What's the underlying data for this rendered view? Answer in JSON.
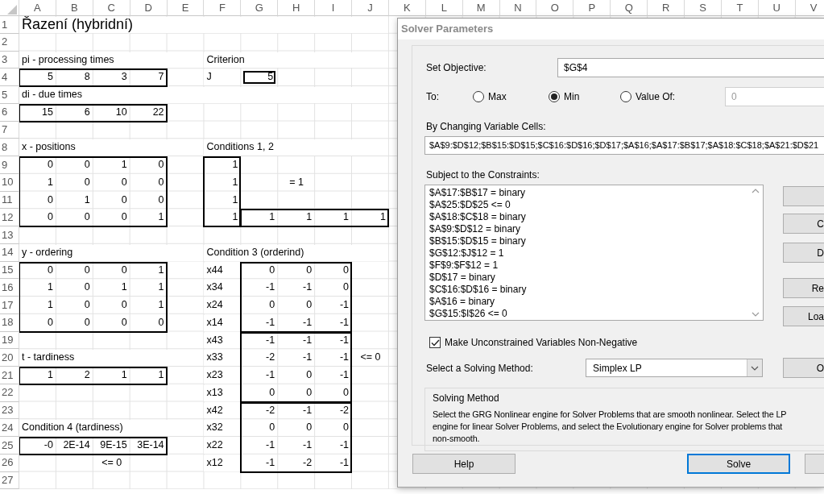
{
  "sheet": {
    "columns": [
      "A",
      "B",
      "C",
      "D",
      "E",
      "F",
      "G",
      "H",
      "I",
      "J",
      "K",
      "L",
      "M",
      "N",
      "O",
      "P",
      "Q",
      "R",
      "S",
      "T",
      "U",
      "V"
    ],
    "rows": [
      {
        "number": "1",
        "cells": [
          {
            "text": "Řazení  (hybridní)",
            "kind": "title"
          }
        ]
      },
      {
        "number": "2"
      },
      {
        "number": "3",
        "cells": [
          {
            "text": "pi  - processing times",
            "kind": "label"
          },
          null,
          null,
          null,
          null,
          {
            "text": "Criterion",
            "kind": "label"
          }
        ]
      },
      {
        "number": "4",
        "cells": [
          {
            "text": "5",
            "kind": "number"
          },
          {
            "text": "8",
            "kind": "number"
          },
          {
            "text": "3",
            "kind": "number"
          },
          {
            "text": "7",
            "kind": "number"
          },
          null,
          {
            "text": "J",
            "kind": "label"
          },
          {
            "text": "5",
            "kind": "number"
          }
        ]
      },
      {
        "number": "5",
        "cells": [
          {
            "text": "di  - due times",
            "kind": "label"
          }
        ]
      },
      {
        "number": "6",
        "cells": [
          {
            "text": "15",
            "kind": "number"
          },
          {
            "text": "6",
            "kind": "number"
          },
          {
            "text": "10",
            "kind": "number"
          },
          {
            "text": "22",
            "kind": "number"
          }
        ]
      },
      {
        "number": "7"
      },
      {
        "number": "8",
        "cells": [
          {
            "text": "x  - positions",
            "kind": "label"
          },
          null,
          null,
          null,
          null,
          {
            "text": "Conditions 1, 2",
            "kind": "label"
          }
        ]
      },
      {
        "number": "9",
        "cells": [
          {
            "text": "0",
            "kind": "number"
          },
          {
            "text": "0",
            "kind": "number"
          },
          {
            "text": "1",
            "kind": "number"
          },
          {
            "text": "0",
            "kind": "number"
          },
          null,
          {
            "text": "1",
            "kind": "number"
          }
        ]
      },
      {
        "number": "10",
        "cells": [
          {
            "text": "1",
            "kind": "number"
          },
          {
            "text": "0",
            "kind": "number"
          },
          {
            "text": "0",
            "kind": "number"
          },
          {
            "text": "0",
            "kind": "number"
          },
          null,
          {
            "text": "1",
            "kind": "number"
          },
          null,
          {
            "text": "= 1",
            "kind": "center"
          }
        ]
      },
      {
        "number": "11",
        "cells": [
          {
            "text": "0",
            "kind": "number"
          },
          {
            "text": "1",
            "kind": "number"
          },
          {
            "text": "0",
            "kind": "number"
          },
          {
            "text": "0",
            "kind": "number"
          },
          null,
          {
            "text": "1",
            "kind": "number"
          }
        ]
      },
      {
        "number": "12",
        "cells": [
          {
            "text": "0",
            "kind": "number"
          },
          {
            "text": "0",
            "kind": "number"
          },
          {
            "text": "0",
            "kind": "number"
          },
          {
            "text": "1",
            "kind": "number"
          },
          null,
          {
            "text": "1",
            "kind": "number"
          },
          {
            "text": "1",
            "kind": "number"
          },
          {
            "text": "1",
            "kind": "number"
          },
          {
            "text": "1",
            "kind": "number"
          },
          {
            "text": "1",
            "kind": "number"
          }
        ]
      },
      {
        "number": "13"
      },
      {
        "number": "14",
        "cells": [
          {
            "text": "y  - ordering",
            "kind": "label"
          },
          null,
          null,
          null,
          null,
          {
            "text": "Condition 3 (orderind)",
            "kind": "label"
          }
        ]
      },
      {
        "number": "15",
        "cells": [
          {
            "text": "0",
            "kind": "number"
          },
          {
            "text": "0",
            "kind": "number"
          },
          {
            "text": "0",
            "kind": "number"
          },
          {
            "text": "1",
            "kind": "number"
          },
          null,
          {
            "text": "x44",
            "kind": "label"
          },
          {
            "text": "0",
            "kind": "number"
          },
          {
            "text": "0",
            "kind": "number"
          },
          {
            "text": "0",
            "kind": "number"
          }
        ]
      },
      {
        "number": "16",
        "cells": [
          {
            "text": "1",
            "kind": "number"
          },
          {
            "text": "0",
            "kind": "number"
          },
          {
            "text": "1",
            "kind": "number"
          },
          {
            "text": "1",
            "kind": "number"
          },
          null,
          {
            "text": "x34",
            "kind": "label"
          },
          {
            "text": "-1",
            "kind": "number"
          },
          {
            "text": "-1",
            "kind": "number"
          },
          {
            "text": "0",
            "kind": "number"
          }
        ]
      },
      {
        "number": "17",
        "cells": [
          {
            "text": "1",
            "kind": "number"
          },
          {
            "text": "0",
            "kind": "number"
          },
          {
            "text": "0",
            "kind": "number"
          },
          {
            "text": "1",
            "kind": "number"
          },
          null,
          {
            "text": "x24",
            "kind": "label"
          },
          {
            "text": "0",
            "kind": "number"
          },
          {
            "text": "0",
            "kind": "number"
          },
          {
            "text": "-1",
            "kind": "number"
          }
        ]
      },
      {
        "number": "18",
        "cells": [
          {
            "text": "0",
            "kind": "number"
          },
          {
            "text": "0",
            "kind": "number"
          },
          {
            "text": "0",
            "kind": "number"
          },
          {
            "text": "0",
            "kind": "number"
          },
          null,
          {
            "text": "x14",
            "kind": "label"
          },
          {
            "text": "-1",
            "kind": "number"
          },
          {
            "text": "-1",
            "kind": "number"
          },
          {
            "text": "-1",
            "kind": "number"
          }
        ]
      },
      {
        "number": "19",
        "cells": [
          null,
          null,
          null,
          null,
          null,
          {
            "text": "x43",
            "kind": "label"
          },
          {
            "text": "-1",
            "kind": "number"
          },
          {
            "text": "-1",
            "kind": "number"
          },
          {
            "text": "-1",
            "kind": "number"
          }
        ]
      },
      {
        "number": "20",
        "cells": [
          {
            "text": "t  - tardiness",
            "kind": "label"
          },
          null,
          null,
          null,
          null,
          {
            "text": "x33",
            "kind": "label"
          },
          {
            "text": "-2",
            "kind": "number"
          },
          {
            "text": "-1",
            "kind": "number"
          },
          {
            "text": "-1",
            "kind": "number"
          },
          {
            "text": "<= 0",
            "kind": "center"
          }
        ]
      },
      {
        "number": "21",
        "cells": [
          {
            "text": "1",
            "kind": "number"
          },
          {
            "text": "2",
            "kind": "number"
          },
          {
            "text": "1",
            "kind": "number"
          },
          {
            "text": "1",
            "kind": "number"
          },
          null,
          {
            "text": "x23",
            "kind": "label"
          },
          {
            "text": "-1",
            "kind": "number"
          },
          {
            "text": "0",
            "kind": "number"
          },
          {
            "text": "-1",
            "kind": "number"
          }
        ]
      },
      {
        "number": "22",
        "cells": [
          null,
          null,
          null,
          null,
          null,
          {
            "text": "x13",
            "kind": "label"
          },
          {
            "text": "0",
            "kind": "number"
          },
          {
            "text": "0",
            "kind": "number"
          },
          {
            "text": "0",
            "kind": "number"
          }
        ]
      },
      {
        "number": "23",
        "cells": [
          null,
          null,
          null,
          null,
          null,
          {
            "text": "x42",
            "kind": "label"
          },
          {
            "text": "-2",
            "kind": "number"
          },
          {
            "text": "-1",
            "kind": "number"
          },
          {
            "text": "-2",
            "kind": "number"
          }
        ]
      },
      {
        "number": "24",
        "cells": [
          {
            "text": "Condition 4 (tardiness)",
            "kind": "label"
          },
          null,
          null,
          null,
          null,
          {
            "text": "x32",
            "kind": "label"
          },
          {
            "text": "0",
            "kind": "number"
          },
          {
            "text": "0",
            "kind": "number"
          },
          {
            "text": "0",
            "kind": "number"
          }
        ]
      },
      {
        "number": "25",
        "cells": [
          {
            "text": "-0",
            "kind": "number"
          },
          {
            "text": "2E-14",
            "kind": "number"
          },
          {
            "text": "9E-15",
            "kind": "number"
          },
          {
            "text": "3E-14",
            "kind": "number"
          },
          null,
          {
            "text": "x22",
            "kind": "label"
          },
          {
            "text": "-1",
            "kind": "number"
          },
          {
            "text": "-1",
            "kind": "number"
          },
          {
            "text": "-1",
            "kind": "number"
          }
        ]
      },
      {
        "number": "26",
        "cells": [
          null,
          null,
          {
            "text": "<= 0",
            "kind": "center"
          },
          null,
          null,
          {
            "text": "x12",
            "kind": "label"
          },
          {
            "text": "-1",
            "kind": "number"
          },
          {
            "text": "-2",
            "kind": "number"
          },
          {
            "text": "-1",
            "kind": "number"
          }
        ]
      },
      {
        "number": "27"
      }
    ]
  },
  "dialog": {
    "title": "Solver Parameters",
    "objective": {
      "label": "Set Objective:",
      "value": "$G$4"
    },
    "to": {
      "label": "To:",
      "options": [
        {
          "label": "Max",
          "selected": false
        },
        {
          "label": "Min",
          "selected": true
        },
        {
          "label": "Value Of:",
          "selected": false
        }
      ],
      "value_field": {
        "value": "0",
        "disabled": true
      }
    },
    "changing": {
      "label": "By Changing Variable Cells:",
      "value": "$A$9:$D$12;$B$15:$D$15;$C$16:$D$16;$D$17;$A$16;$A$17:$B$17;$A$18:$C$18;$A$21:$D$21"
    },
    "constraints": {
      "label": "Subject to the Constraints:",
      "items": [
        "$A$17:$B$17 = binary",
        "$A$25:$D$25 <= 0",
        "$A$18:$C$18 = binary",
        "$A$9:$D$12 = binary",
        "$B$15:$D$15 = binary",
        "$G$12:$J$12 = 1",
        "$F$9:$F$12 = 1",
        "$D$17 = binary",
        "$C$16:$D$16 = binary",
        "$A$16 = binary",
        "$G$15:$I$26 <= 0"
      ]
    },
    "side_buttons": [
      {
        "label": "C"
      },
      {
        "label": "D"
      },
      {
        "label": "Re"
      },
      {
        "label": "Loa"
      }
    ],
    "nonnegative": {
      "label": "Make Unconstrained Variables Non-Negative",
      "checked": true
    },
    "method": {
      "label": "Select a Solving Method:",
      "value": "Simplex LP"
    },
    "options_button": {
      "label": "O"
    },
    "description": {
      "title": "Solving Method",
      "lines": [
        "Select the GRG Nonlinear engine for Solver Problems that are smooth nonlinear. Select the LP",
        "engine for linear Solver Problems, and select the Evolutionary engine for Solver problems that",
        "non-smooth."
      ]
    },
    "buttons": [
      {
        "label": "Help",
        "focused": false
      },
      {
        "label": "Solve",
        "focused": true
      }
    ]
  }
}
